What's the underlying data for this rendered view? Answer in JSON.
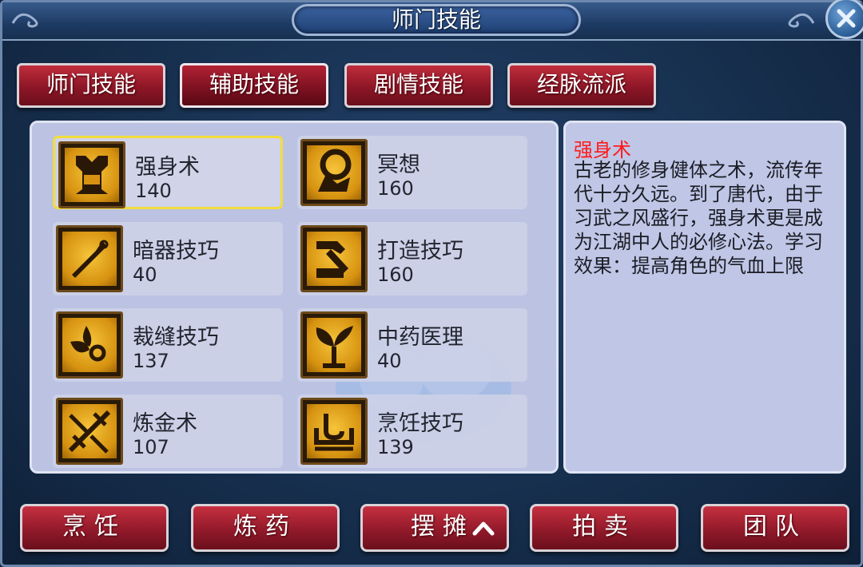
{
  "window": {
    "title": "师门技能"
  },
  "tabs": [
    {
      "label": "师门技能"
    },
    {
      "label": "辅助技能",
      "active": true
    },
    {
      "label": "剧情技能"
    },
    {
      "label": "经脉流派"
    }
  ],
  "skills": [
    {
      "name": "强身术",
      "level": "140",
      "icon": "warrior-emblem-icon",
      "selected": true
    },
    {
      "name": "冥想",
      "level": "160",
      "icon": "meditation-icon"
    },
    {
      "name": "暗器技巧",
      "level": "40",
      "icon": "dagger-icon"
    },
    {
      "name": "打造技巧",
      "level": "160",
      "icon": "hammer-anvil-icon"
    },
    {
      "name": "裁缝技巧",
      "level": "137",
      "icon": "scissors-icon"
    },
    {
      "name": "中药医理",
      "level": "40",
      "icon": "herb-leaf-icon"
    },
    {
      "name": "炼金术",
      "level": "107",
      "icon": "alchemy-icon"
    },
    {
      "name": "烹饪技巧",
      "level": "139",
      "icon": "cooking-icon"
    }
  ],
  "description": {
    "title": "强身术",
    "body": "古老的修身健体之术，流传年代十分久远。到了唐代，由于习武之风盛行，强身术更是成为江湖中人的必修心法。学习效果：提高角色的气血上限"
  },
  "bottom_buttons": [
    {
      "label": "烹饪"
    },
    {
      "label": "炼药"
    },
    {
      "label": "摆摊",
      "has_chevron": true,
      "icon": "chevron-up-icon"
    },
    {
      "label": "拍卖"
    },
    {
      "label": "团队"
    }
  ],
  "colors": {
    "tab_red": "#8d1626",
    "panel_bg": "#bcc2e2",
    "selected_border": "#f2dc3c",
    "desc_title": "#ff1b1b",
    "icon_gold": "#d69210"
  }
}
